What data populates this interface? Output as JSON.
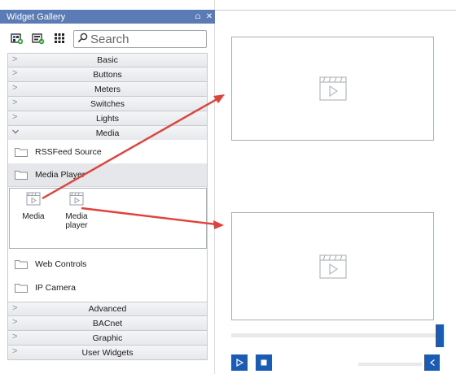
{
  "panel": {
    "title": "Widget Gallery",
    "pin_glyph": "⩍",
    "close_glyph": "✕",
    "search_placeholder": "Search"
  },
  "categories_top": [
    {
      "label": "Basic"
    },
    {
      "label": "Buttons"
    },
    {
      "label": "Meters"
    },
    {
      "label": "Switches"
    },
    {
      "label": "Lights"
    },
    {
      "label": "Media"
    }
  ],
  "media": {
    "folders": {
      "rss": "RSSFeed Source",
      "player": "Media Player",
      "web": "Web Controls",
      "ipcam": "IP Camera"
    },
    "items": [
      {
        "label": "Media"
      },
      {
        "label": "Media player"
      }
    ]
  },
  "categories_bottom": [
    {
      "label": "Advanced"
    },
    {
      "label": "BACnet"
    },
    {
      "label": "Graphic"
    },
    {
      "label": "User Widgets"
    }
  ],
  "colors": {
    "titlebar": "#5a7bb6",
    "accent": "#1a5bb5",
    "arrow": "#e0413a"
  },
  "icons": {
    "toolbar": [
      "add-widget-icon",
      "edit-widget-icon",
      "grid-view-icon"
    ],
    "player": [
      "play-icon",
      "stop-icon",
      "volume-icon"
    ]
  }
}
